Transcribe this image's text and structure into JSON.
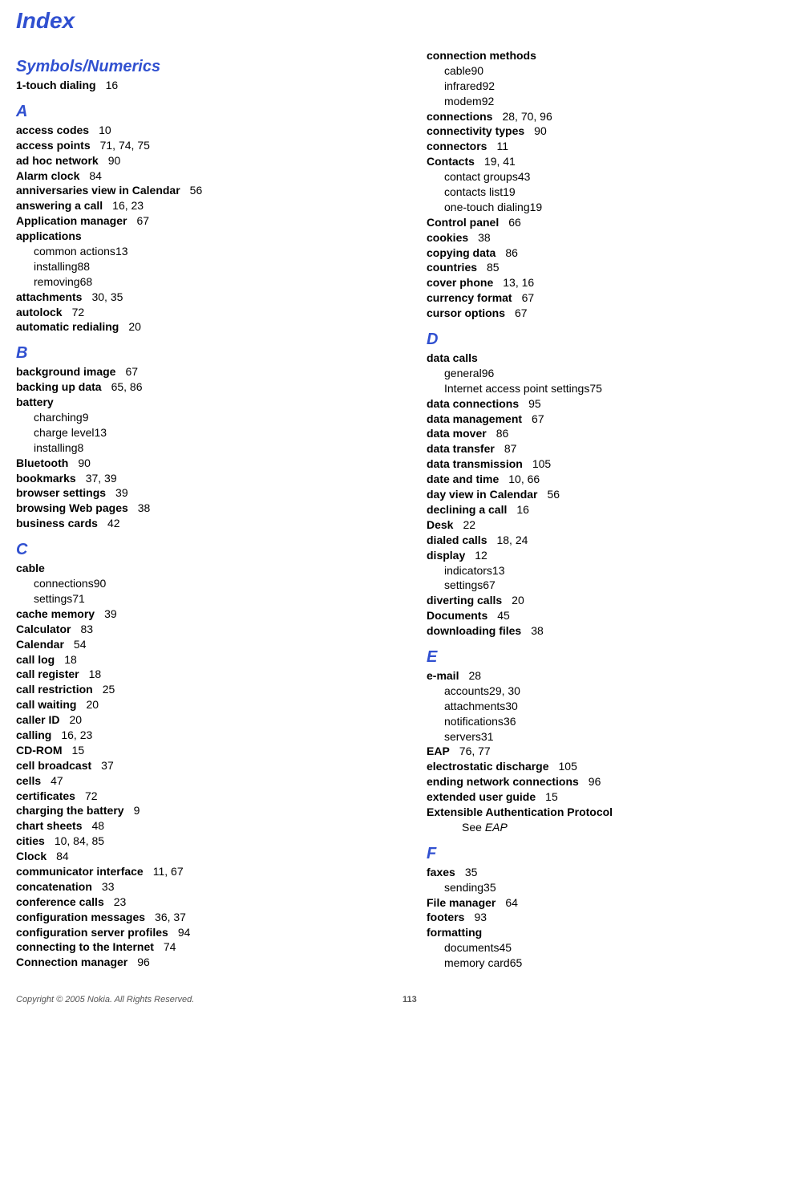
{
  "title": "Index",
  "footer": {
    "copyright": "Copyright © 2005 Nokia. All Rights Reserved.",
    "page": "113"
  },
  "left": [
    {
      "type": "section",
      "label": "Symbols/Numerics"
    },
    {
      "type": "entry",
      "term": "1-touch dialing",
      "pages": "16"
    },
    {
      "type": "section",
      "label": "A"
    },
    {
      "type": "entry",
      "term": "access codes",
      "pages": "10"
    },
    {
      "type": "entry",
      "term": "access points",
      "pages": "71, 74, 75"
    },
    {
      "type": "entry",
      "term": "ad hoc network",
      "pages": "90"
    },
    {
      "type": "entry",
      "term": "Alarm clock",
      "pages": "84"
    },
    {
      "type": "entry",
      "term": "anniversaries view in Calendar",
      "pages": "56"
    },
    {
      "type": "entry",
      "term": "answering a call",
      "pages": "16, 23"
    },
    {
      "type": "entry",
      "term": "Application manager",
      "pages": "67"
    },
    {
      "type": "entry",
      "term": "applications",
      "pages": ""
    },
    {
      "type": "sub",
      "term": "common actions",
      "pages": "13"
    },
    {
      "type": "sub",
      "term": "installing",
      "pages": "88"
    },
    {
      "type": "sub",
      "term": "removing",
      "pages": "68"
    },
    {
      "type": "entry",
      "term": "attachments",
      "pages": "30, 35"
    },
    {
      "type": "entry",
      "term": "autolock",
      "pages": "72"
    },
    {
      "type": "entry",
      "term": "automatic redialing",
      "pages": "20"
    },
    {
      "type": "section",
      "label": "B"
    },
    {
      "type": "entry",
      "term": "background image",
      "pages": "67"
    },
    {
      "type": "entry",
      "term": "backing up data",
      "pages": "65, 86"
    },
    {
      "type": "entry",
      "term": "battery",
      "pages": ""
    },
    {
      "type": "sub",
      "term": "charching",
      "pages": "9"
    },
    {
      "type": "sub",
      "term": "charge level",
      "pages": "13"
    },
    {
      "type": "sub",
      "term": "installing",
      "pages": "8"
    },
    {
      "type": "entry",
      "term": "Bluetooth",
      "pages": "90"
    },
    {
      "type": "entry",
      "term": "bookmarks",
      "pages": "37, 39"
    },
    {
      "type": "entry",
      "term": "browser settings",
      "pages": "39"
    },
    {
      "type": "entry",
      "term": "browsing Web pages",
      "pages": "38"
    },
    {
      "type": "entry",
      "term": "business cards",
      "pages": "42"
    },
    {
      "type": "section",
      "label": "C"
    },
    {
      "type": "entry",
      "term": "cable",
      "pages": ""
    },
    {
      "type": "sub",
      "term": "connections",
      "pages": "90"
    },
    {
      "type": "sub",
      "term": "settings",
      "pages": "71"
    },
    {
      "type": "entry",
      "term": "cache memory",
      "pages": "39"
    },
    {
      "type": "entry",
      "term": "Calculator",
      "pages": "83"
    },
    {
      "type": "entry",
      "term": "Calendar",
      "pages": "54"
    },
    {
      "type": "entry",
      "term": "call log",
      "pages": "18"
    },
    {
      "type": "entry",
      "term": "call register",
      "pages": "18"
    },
    {
      "type": "entry",
      "term": "call restriction",
      "pages": "25"
    },
    {
      "type": "entry",
      "term": "call waiting",
      "pages": "20"
    },
    {
      "type": "entry",
      "term": "caller ID",
      "pages": "20"
    },
    {
      "type": "entry",
      "term": "calling",
      "pages": "16, 23"
    },
    {
      "type": "entry",
      "term": "CD-ROM",
      "pages": "15"
    },
    {
      "type": "entry",
      "term": "cell broadcast",
      "pages": "37"
    },
    {
      "type": "entry",
      "term": "cells",
      "pages": "47"
    },
    {
      "type": "entry",
      "term": "certificates",
      "pages": "72"
    },
    {
      "type": "entry",
      "term": "charging the battery",
      "pages": "9"
    },
    {
      "type": "entry",
      "term": "chart sheets",
      "pages": "48"
    },
    {
      "type": "entry",
      "term": "cities",
      "pages": "10, 84, 85"
    },
    {
      "type": "entry",
      "term": "Clock",
      "pages": "84"
    },
    {
      "type": "entry",
      "term": "communicator interface",
      "pages": "11, 67"
    },
    {
      "type": "entry",
      "term": "concatenation",
      "pages": "33"
    },
    {
      "type": "entry",
      "term": "conference calls",
      "pages": "23"
    },
    {
      "type": "entry",
      "term": "configuration messages",
      "pages": "36, 37"
    },
    {
      "type": "entry",
      "term": "configuration server profiles",
      "pages": "94"
    },
    {
      "type": "entry",
      "term": "connecting to the Internet",
      "pages": "74"
    },
    {
      "type": "entry",
      "term": "Connection manager",
      "pages": "96"
    }
  ],
  "right": [
    {
      "type": "entry",
      "term": "connection methods",
      "pages": ""
    },
    {
      "type": "sub",
      "term": "cable",
      "pages": "90"
    },
    {
      "type": "sub",
      "term": "infrared",
      "pages": "92"
    },
    {
      "type": "sub",
      "term": "modem",
      "pages": "92"
    },
    {
      "type": "entry",
      "term": "connections",
      "pages": "28, 70, 96"
    },
    {
      "type": "entry",
      "term": "connectivity types",
      "pages": "90"
    },
    {
      "type": "entry",
      "term": "connectors",
      "pages": "11"
    },
    {
      "type": "entry",
      "term": "Contacts",
      "pages": "19, 41"
    },
    {
      "type": "sub",
      "term": "contact groups",
      "pages": "43"
    },
    {
      "type": "sub",
      "term": "contacts list",
      "pages": "19"
    },
    {
      "type": "sub",
      "term": "one-touch dialing",
      "pages": "19"
    },
    {
      "type": "entry",
      "term": "Control panel",
      "pages": "66"
    },
    {
      "type": "entry",
      "term": "cookies",
      "pages": "38"
    },
    {
      "type": "entry",
      "term": "copying data",
      "pages": "86"
    },
    {
      "type": "entry",
      "term": "countries",
      "pages": "85"
    },
    {
      "type": "entry",
      "term": "cover phone",
      "pages": "13, 16"
    },
    {
      "type": "entry",
      "term": "currency format",
      "pages": "67"
    },
    {
      "type": "entry",
      "term": "cursor options",
      "pages": "67"
    },
    {
      "type": "section",
      "label": "D"
    },
    {
      "type": "entry",
      "term": "data calls",
      "pages": ""
    },
    {
      "type": "sub",
      "term": "general",
      "pages": "96"
    },
    {
      "type": "sub",
      "term": "Internet access point settings",
      "pages": "75"
    },
    {
      "type": "entry",
      "term": "data connections",
      "pages": "95"
    },
    {
      "type": "entry",
      "term": "data management",
      "pages": "67"
    },
    {
      "type": "entry",
      "term": "data mover",
      "pages": "86"
    },
    {
      "type": "entry",
      "term": "data transfer",
      "pages": "87"
    },
    {
      "type": "entry",
      "term": "data transmission",
      "pages": "105"
    },
    {
      "type": "entry",
      "term": "date and time",
      "pages": "10, 66"
    },
    {
      "type": "entry",
      "term": "day view in Calendar",
      "pages": "56"
    },
    {
      "type": "entry",
      "term": "declining a call",
      "pages": "16"
    },
    {
      "type": "entry",
      "term": "Desk",
      "pages": "22"
    },
    {
      "type": "entry",
      "term": "dialed calls",
      "pages": "18, 24"
    },
    {
      "type": "entry",
      "term": "display",
      "pages": "12"
    },
    {
      "type": "sub",
      "term": "indicators",
      "pages": "13"
    },
    {
      "type": "sub",
      "term": "settings",
      "pages": "67"
    },
    {
      "type": "entry",
      "term": "diverting calls",
      "pages": "20"
    },
    {
      "type": "entry",
      "term": "Documents",
      "pages": "45"
    },
    {
      "type": "entry",
      "term": "downloading files",
      "pages": "38"
    },
    {
      "type": "section",
      "label": "E"
    },
    {
      "type": "entry",
      "term": "e-mail",
      "pages": "28"
    },
    {
      "type": "sub",
      "term": "accounts",
      "pages": "29, 30"
    },
    {
      "type": "sub",
      "term": "attachments",
      "pages": "30"
    },
    {
      "type": "sub",
      "term": "notifications",
      "pages": "36"
    },
    {
      "type": "sub",
      "term": "servers",
      "pages": "31"
    },
    {
      "type": "entry",
      "term": "EAP",
      "pages": "76, 77"
    },
    {
      "type": "entry",
      "term": "electrostatic discharge",
      "pages": "105"
    },
    {
      "type": "entry",
      "term": "ending network connections",
      "pages": "96"
    },
    {
      "type": "entry",
      "term": "extended user guide",
      "pages": "15"
    },
    {
      "type": "entry",
      "term": "Extensible Authentication Protocol",
      "pages": ""
    },
    {
      "type": "subsub",
      "term": "See",
      "pages": "EAP"
    },
    {
      "type": "section",
      "label": "F"
    },
    {
      "type": "entry",
      "term": "faxes",
      "pages": "35"
    },
    {
      "type": "sub",
      "term": "sending",
      "pages": "35"
    },
    {
      "type": "entry",
      "term": "File manager",
      "pages": "64"
    },
    {
      "type": "entry",
      "term": "footers",
      "pages": "93"
    },
    {
      "type": "entry",
      "term": "formatting",
      "pages": ""
    },
    {
      "type": "sub",
      "term": "documents",
      "pages": "45"
    },
    {
      "type": "sub",
      "term": "memory card",
      "pages": "65"
    }
  ]
}
